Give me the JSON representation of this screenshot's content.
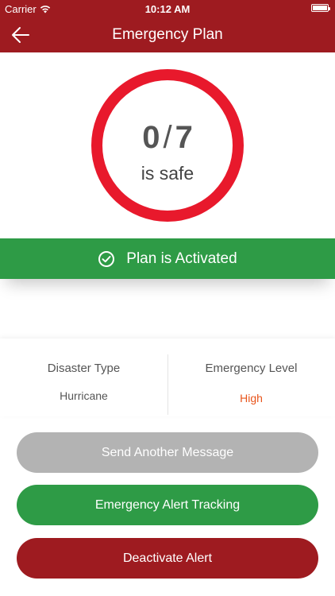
{
  "status_bar": {
    "carrier": "Carrier",
    "time": "10:12 AM"
  },
  "nav": {
    "title": "Emergency Plan"
  },
  "safety": {
    "safe_count": "0",
    "separator": "/",
    "total": "7",
    "caption": "is safe"
  },
  "banner": {
    "text": "Plan is Activated",
    "color": "#2e9b46"
  },
  "info": {
    "disaster_type_label": "Disaster Type",
    "disaster_type_value": "Hurricane",
    "emergency_level_label": "Emergency Level",
    "emergency_level_value": "High"
  },
  "buttons": {
    "send_message": "Send Another Message",
    "tracking": "Emergency Alert Tracking",
    "deactivate": "Deactivate Alert"
  },
  "colors": {
    "brand": "#9e1b20",
    "ring": "#e8192c",
    "success": "#2e9b46",
    "neutral": "#b3b3b3",
    "level_high": "#e8541b"
  }
}
